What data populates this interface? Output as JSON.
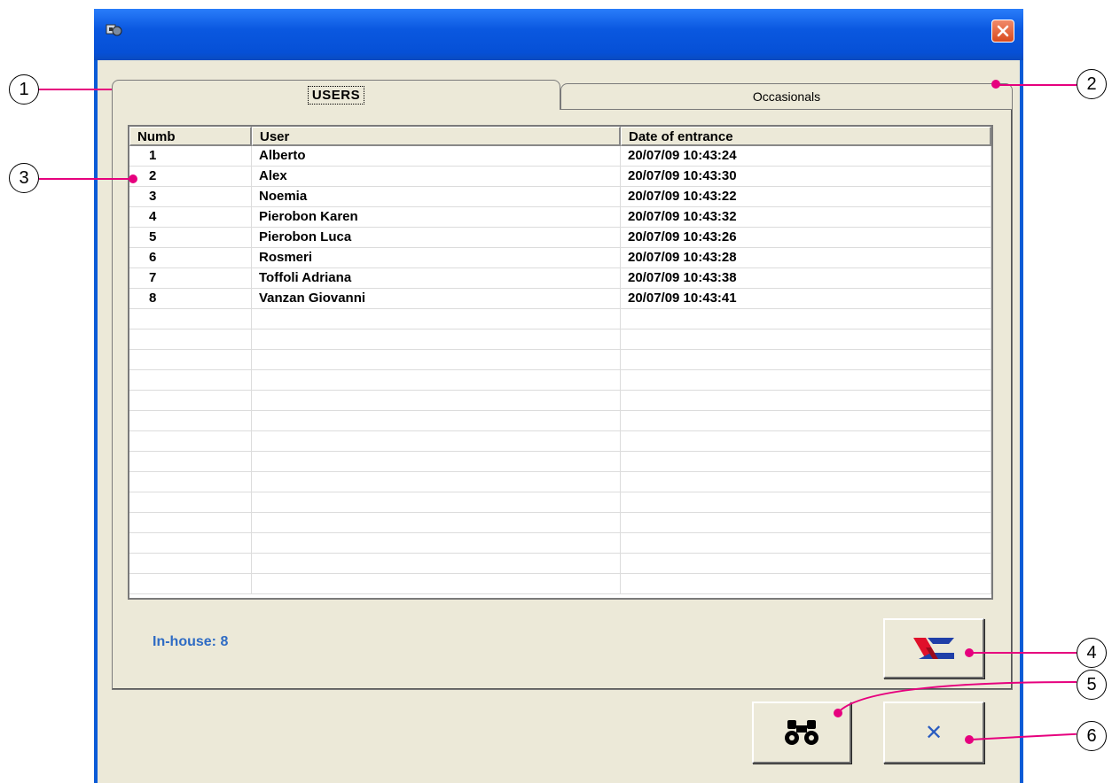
{
  "window": {
    "title": "",
    "icon": "app-icon",
    "close_icon": "close-icon"
  },
  "tabs": [
    {
      "label": "USERS",
      "active": true
    },
    {
      "label": "Occasionals",
      "active": false
    }
  ],
  "table": {
    "columns": [
      "Numb",
      "User",
      "Date of entrance"
    ],
    "rows": [
      {
        "numb": "1",
        "user": "Alberto",
        "date": "20/07/09 10:43:24"
      },
      {
        "numb": "2",
        "user": "Alex",
        "date": "20/07/09 10:43:30"
      },
      {
        "numb": "3",
        "user": "Noemia",
        "date": "20/07/09 10:43:22"
      },
      {
        "numb": "4",
        "user": "Pierobon Karen",
        "date": "20/07/09 10:43:32"
      },
      {
        "numb": "5",
        "user": "Pierobon Luca",
        "date": "20/07/09 10:43:26"
      },
      {
        "numb": "6",
        "user": "Rosmeri",
        "date": "20/07/09 10:43:28"
      },
      {
        "numb": "7",
        "user": "Toffoli Adriana",
        "date": "20/07/09 10:43:38"
      },
      {
        "numb": "8",
        "user": "Vanzan Giovanni",
        "date": "20/07/09 10:43:41"
      }
    ]
  },
  "status": {
    "in_house": "In-house: 8"
  },
  "buttons": {
    "logo": {
      "icon": "logo-icon"
    },
    "search": {
      "icon": "binoculars-icon"
    },
    "close": {
      "label": "✕",
      "icon": "close-icon"
    }
  },
  "callouts": [
    "1",
    "2",
    "3",
    "4",
    "5",
    "6"
  ],
  "colors": {
    "callout_line": "#e6007e",
    "titlebar": "#0a58e0",
    "face": "#ece9d8",
    "status_text": "#2e6bc4"
  }
}
